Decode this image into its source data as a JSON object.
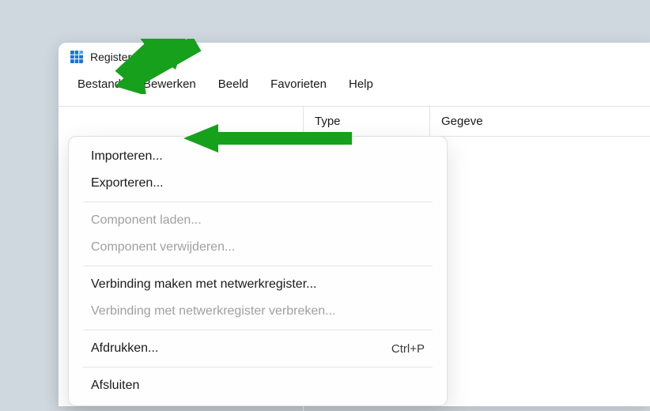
{
  "window": {
    "title": "Register-editor"
  },
  "menubar": {
    "items": [
      {
        "label": "Bestand"
      },
      {
        "label": "Bewerken"
      },
      {
        "label": "Beeld"
      },
      {
        "label": "Favorieten"
      },
      {
        "label": "Help"
      }
    ]
  },
  "dropdown": {
    "items": [
      {
        "label": "Importeren...",
        "enabled": true
      },
      {
        "label": "Exporteren...",
        "enabled": true
      }
    ],
    "group2": [
      {
        "label": "Component laden...",
        "enabled": false
      },
      {
        "label": "Component verwijderen...",
        "enabled": false
      }
    ],
    "group3": [
      {
        "label": "Verbinding maken met netwerkregister...",
        "enabled": true
      },
      {
        "label": "Verbinding met netwerkregister verbreken...",
        "enabled": false
      }
    ],
    "group4": [
      {
        "label": "Afdrukken...",
        "enabled": true,
        "shortcut": "Ctrl+P"
      }
    ],
    "group5": [
      {
        "label": "Afsluiten",
        "enabled": true
      }
    ]
  },
  "columns": {
    "type": "Type",
    "data": "Gegeve"
  }
}
